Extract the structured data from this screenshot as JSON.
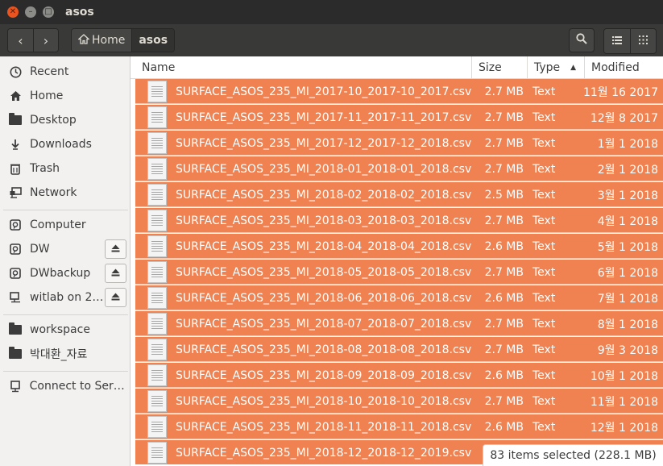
{
  "window": {
    "title": "asos",
    "close_glyph": "✕",
    "minimize_glyph": "–",
    "maximize_glyph": "□"
  },
  "toolbar": {
    "back_icon": "‹",
    "forward_icon": "›",
    "breadcrumbs": [
      "Home",
      "asos"
    ],
    "search_icon": "search-icon",
    "list_view_icon": "list-view-icon",
    "grid_view_icon": "grid-view-icon"
  },
  "sidebar": {
    "items": [
      {
        "label": "Recent",
        "icon": "clock-icon"
      },
      {
        "label": "Home",
        "icon": "home-icon"
      },
      {
        "label": "Desktop",
        "icon": "folder-icon"
      },
      {
        "label": "Downloads",
        "icon": "download-icon"
      },
      {
        "label": "Trash",
        "icon": "trash-icon"
      },
      {
        "label": "Network",
        "icon": "network-icon"
      },
      {
        "label": "Computer",
        "icon": "drive-icon"
      },
      {
        "label": "DW",
        "icon": "drive-icon",
        "eject": true
      },
      {
        "label": "DWbackup",
        "icon": "drive-icon",
        "eject": true
      },
      {
        "label": "witlab on 2…",
        "icon": "network-share-icon",
        "eject": true
      },
      {
        "label": "workspace",
        "icon": "folder-icon"
      },
      {
        "label": "박대환_자료",
        "icon": "folder-icon"
      },
      {
        "label": "Connect to Server",
        "icon": "server-icon"
      }
    ]
  },
  "columns": {
    "name": "Name",
    "size": "Size",
    "type": "Type",
    "modified": "Modified",
    "sorted_by": "Type",
    "sort_direction": "ascending"
  },
  "files": [
    {
      "name": "SURFACE_ASOS_235_MI_2017-10_2017-10_2017.csv",
      "size": "2.7 MB",
      "type": "Text",
      "modified": "11월 16 2017"
    },
    {
      "name": "SURFACE_ASOS_235_MI_2017-11_2017-11_2017.csv",
      "size": "2.7 MB",
      "type": "Text",
      "modified": "12월 8 2017"
    },
    {
      "name": "SURFACE_ASOS_235_MI_2017-12_2017-12_2018.csv",
      "size": "2.7 MB",
      "type": "Text",
      "modified": "1월 1 2018"
    },
    {
      "name": "SURFACE_ASOS_235_MI_2018-01_2018-01_2018.csv",
      "size": "2.7 MB",
      "type": "Text",
      "modified": "2월 1 2018"
    },
    {
      "name": "SURFACE_ASOS_235_MI_2018-02_2018-02_2018.csv",
      "size": "2.5 MB",
      "type": "Text",
      "modified": "3월 1 2018"
    },
    {
      "name": "SURFACE_ASOS_235_MI_2018-03_2018-03_2018.csv",
      "size": "2.7 MB",
      "type": "Text",
      "modified": "4월 1 2018"
    },
    {
      "name": "SURFACE_ASOS_235_MI_2018-04_2018-04_2018.csv",
      "size": "2.6 MB",
      "type": "Text",
      "modified": "5월 1 2018"
    },
    {
      "name": "SURFACE_ASOS_235_MI_2018-05_2018-05_2018.csv",
      "size": "2.7 MB",
      "type": "Text",
      "modified": "6월 1 2018"
    },
    {
      "name": "SURFACE_ASOS_235_MI_2018-06_2018-06_2018.csv",
      "size": "2.6 MB",
      "type": "Text",
      "modified": "7월 1 2018"
    },
    {
      "name": "SURFACE_ASOS_235_MI_2018-07_2018-07_2018.csv",
      "size": "2.7 MB",
      "type": "Text",
      "modified": "8월 1 2018"
    },
    {
      "name": "SURFACE_ASOS_235_MI_2018-08_2018-08_2018.csv",
      "size": "2.7 MB",
      "type": "Text",
      "modified": "9월 3 2018"
    },
    {
      "name": "SURFACE_ASOS_235_MI_2018-09_2018-09_2018.csv",
      "size": "2.6 MB",
      "type": "Text",
      "modified": "10월 1 2018"
    },
    {
      "name": "SURFACE_ASOS_235_MI_2018-10_2018-10_2018.csv",
      "size": "2.7 MB",
      "type": "Text",
      "modified": "11월 1 2018"
    },
    {
      "name": "SURFACE_ASOS_235_MI_2018-11_2018-11_2018.csv",
      "size": "2.6 MB",
      "type": "Text",
      "modified": "12월 1 2018"
    },
    {
      "name": "SURFACE_ASOS_235_MI_2018-12_2018-12_2019.csv",
      "size": "",
      "type": "",
      "modified": ""
    }
  ],
  "status": {
    "text": "83 items selected  (228.1 MB)"
  },
  "colors": {
    "selection": "#ef8250",
    "accent": "#e95420"
  }
}
